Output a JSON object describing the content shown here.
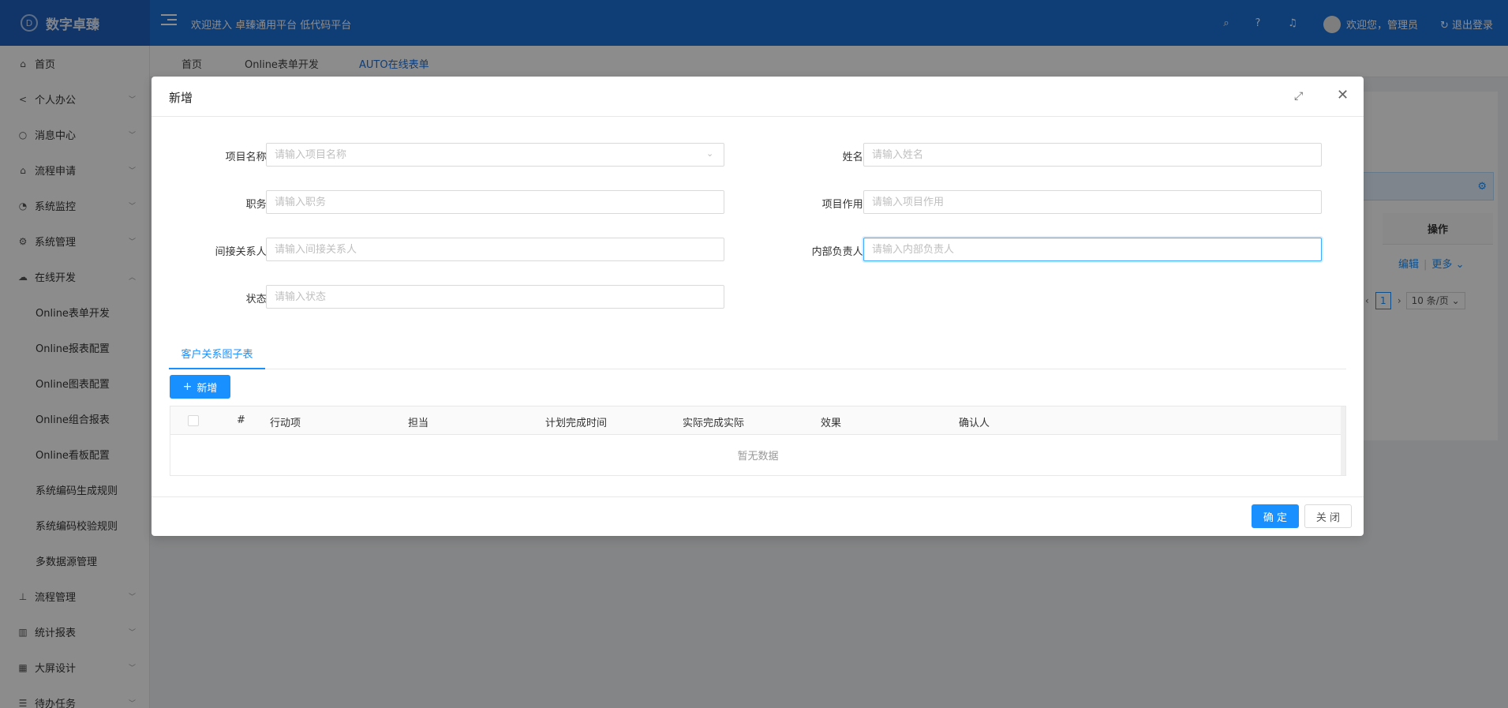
{
  "header": {
    "logo_mark": "D",
    "logo_text": "数字卓臻",
    "welcome": "欢迎进入 卓臻通用平台 低代码平台",
    "user": "欢迎您，管理员",
    "logout": "退出登录",
    "icons": [
      "search-icon",
      "help-icon",
      "bell-icon"
    ]
  },
  "sidebar": {
    "items": [
      {
        "label": "首页",
        "icon": "home-icon",
        "glyph": "⌂"
      },
      {
        "label": "个人办公",
        "icon": "share-icon",
        "glyph": "<"
      },
      {
        "label": "消息中心",
        "icon": "message-icon",
        "glyph": "○"
      },
      {
        "label": "流程申请",
        "icon": "bell-icon",
        "glyph": "⌂"
      },
      {
        "label": "系统监控",
        "icon": "dashboard-icon",
        "glyph": "◔"
      },
      {
        "label": "系统管理",
        "icon": "gear-icon",
        "glyph": "⚙"
      },
      {
        "label": "在线开发",
        "icon": "cloud-icon",
        "glyph": "☁"
      }
    ],
    "sub_items": [
      "Online表单开发",
      "Online报表配置",
      "Online图表配置",
      "Online组合报表",
      "Online看板配置",
      "系统编码生成规则",
      "系统编码校验规则",
      "多数据源管理"
    ],
    "bottom_items": [
      {
        "label": "流程管理",
        "icon": "flow-icon",
        "glyph": "⊥"
      },
      {
        "label": "统计报表",
        "icon": "bar-chart-icon",
        "glyph": "▥"
      },
      {
        "label": "大屏设计",
        "icon": "area-chart-icon",
        "glyph": "▦"
      },
      {
        "label": "待办任务",
        "icon": "list-icon",
        "glyph": "☰"
      }
    ]
  },
  "page_tabs": [
    "首页",
    "Online表单开发",
    "AUTO在线表单"
  ],
  "background": {
    "op_header": "操作",
    "edit": "编辑",
    "more": "更多",
    "page_num": "1",
    "page_size": "10 条/页"
  },
  "modal": {
    "title": "新增",
    "fields": {
      "project_name": {
        "label": "项目名称:",
        "placeholder": "请输入项目名称"
      },
      "name": {
        "label": "姓名:",
        "placeholder": "请输入姓名"
      },
      "position": {
        "label": "职务:",
        "placeholder": "请输入职务"
      },
      "project_role": {
        "label": "项目作用:",
        "placeholder": "请输入项目作用"
      },
      "indirect_contact": {
        "label": "间接关系人:",
        "placeholder": "请输入间接关系人"
      },
      "internal_owner": {
        "label": "内部负责人:",
        "placeholder": "请输入内部负责人"
      },
      "status": {
        "label": "状态:",
        "placeholder": "请输入状态"
      }
    },
    "sub_tab": "客户关系图子表",
    "add_button": "新增",
    "table": {
      "columns": [
        "#",
        "行动项",
        "担当",
        "计划完成时间",
        "实际完成实际",
        "效果",
        "确认人"
      ],
      "empty": "暂无数据"
    },
    "ok": "确 定",
    "close": "关 闭"
  }
}
